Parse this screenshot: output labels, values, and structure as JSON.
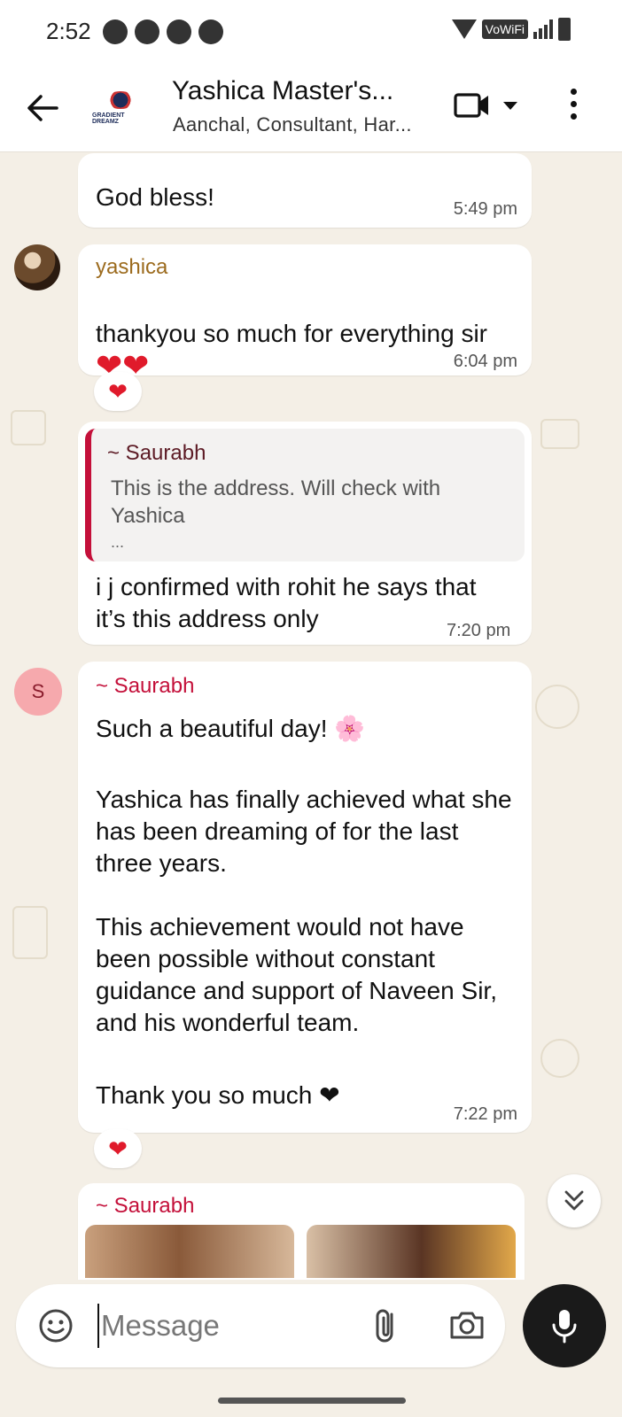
{
  "status_bar": {
    "time": "2:52",
    "network_label": "VoWiFi"
  },
  "header": {
    "back_icon": "arrow-left-icon",
    "group_title": "Yashica Master's...",
    "participants": "Aanchal, Consultant, Har...",
    "group_logo_text": "GRADIENT DREAMZ"
  },
  "messages": [
    {
      "text": "God bless!",
      "time": "5:49 pm"
    },
    {
      "sender": "yashica",
      "sender_color": "#9c6b1e",
      "text": "thankyou so much for everything sir",
      "text_emoji": "❤❤",
      "time": "6:04 pm",
      "reaction": "❤"
    },
    {
      "quote": {
        "sender": "~ Saurabh",
        "text": "This is the address. Will check with Yashica",
        "ellipsis": "..."
      },
      "text": "i j confirmed with rohit he says that it’s this address only",
      "time": "7:20 pm"
    },
    {
      "sender": "~ Saurabh",
      "sender_color": "#c4103a",
      "avatar_initial": "S",
      "p1": "Such a beautiful day! 🌸",
      "p2": "Yashica has finally achieved what she has been dreaming of for the last three years.",
      "p3": "This achievement would not have been possible without constant guidance and support of Naveen Sir, and his wonderful team.",
      "p4": "Thank you so much ❤",
      "time": "7:22 pm",
      "reaction": "❤"
    },
    {
      "sender": "~ Saurabh"
    }
  ],
  "composer": {
    "placeholder": "Message"
  },
  "icons": {
    "sticker": "sticker-icon",
    "attach": "paperclip-icon",
    "camera": "camera-icon",
    "mic": "microphone-icon",
    "video": "video-call-icon",
    "more": "more-vertical-icon",
    "scroll_down": "chevron-double-down-icon"
  },
  "colors": {
    "heart": "#e01a2b",
    "saurabh_name": "#c4103a",
    "quote_bar": "#c4103a",
    "yashica_name": "#9c6b1e"
  }
}
